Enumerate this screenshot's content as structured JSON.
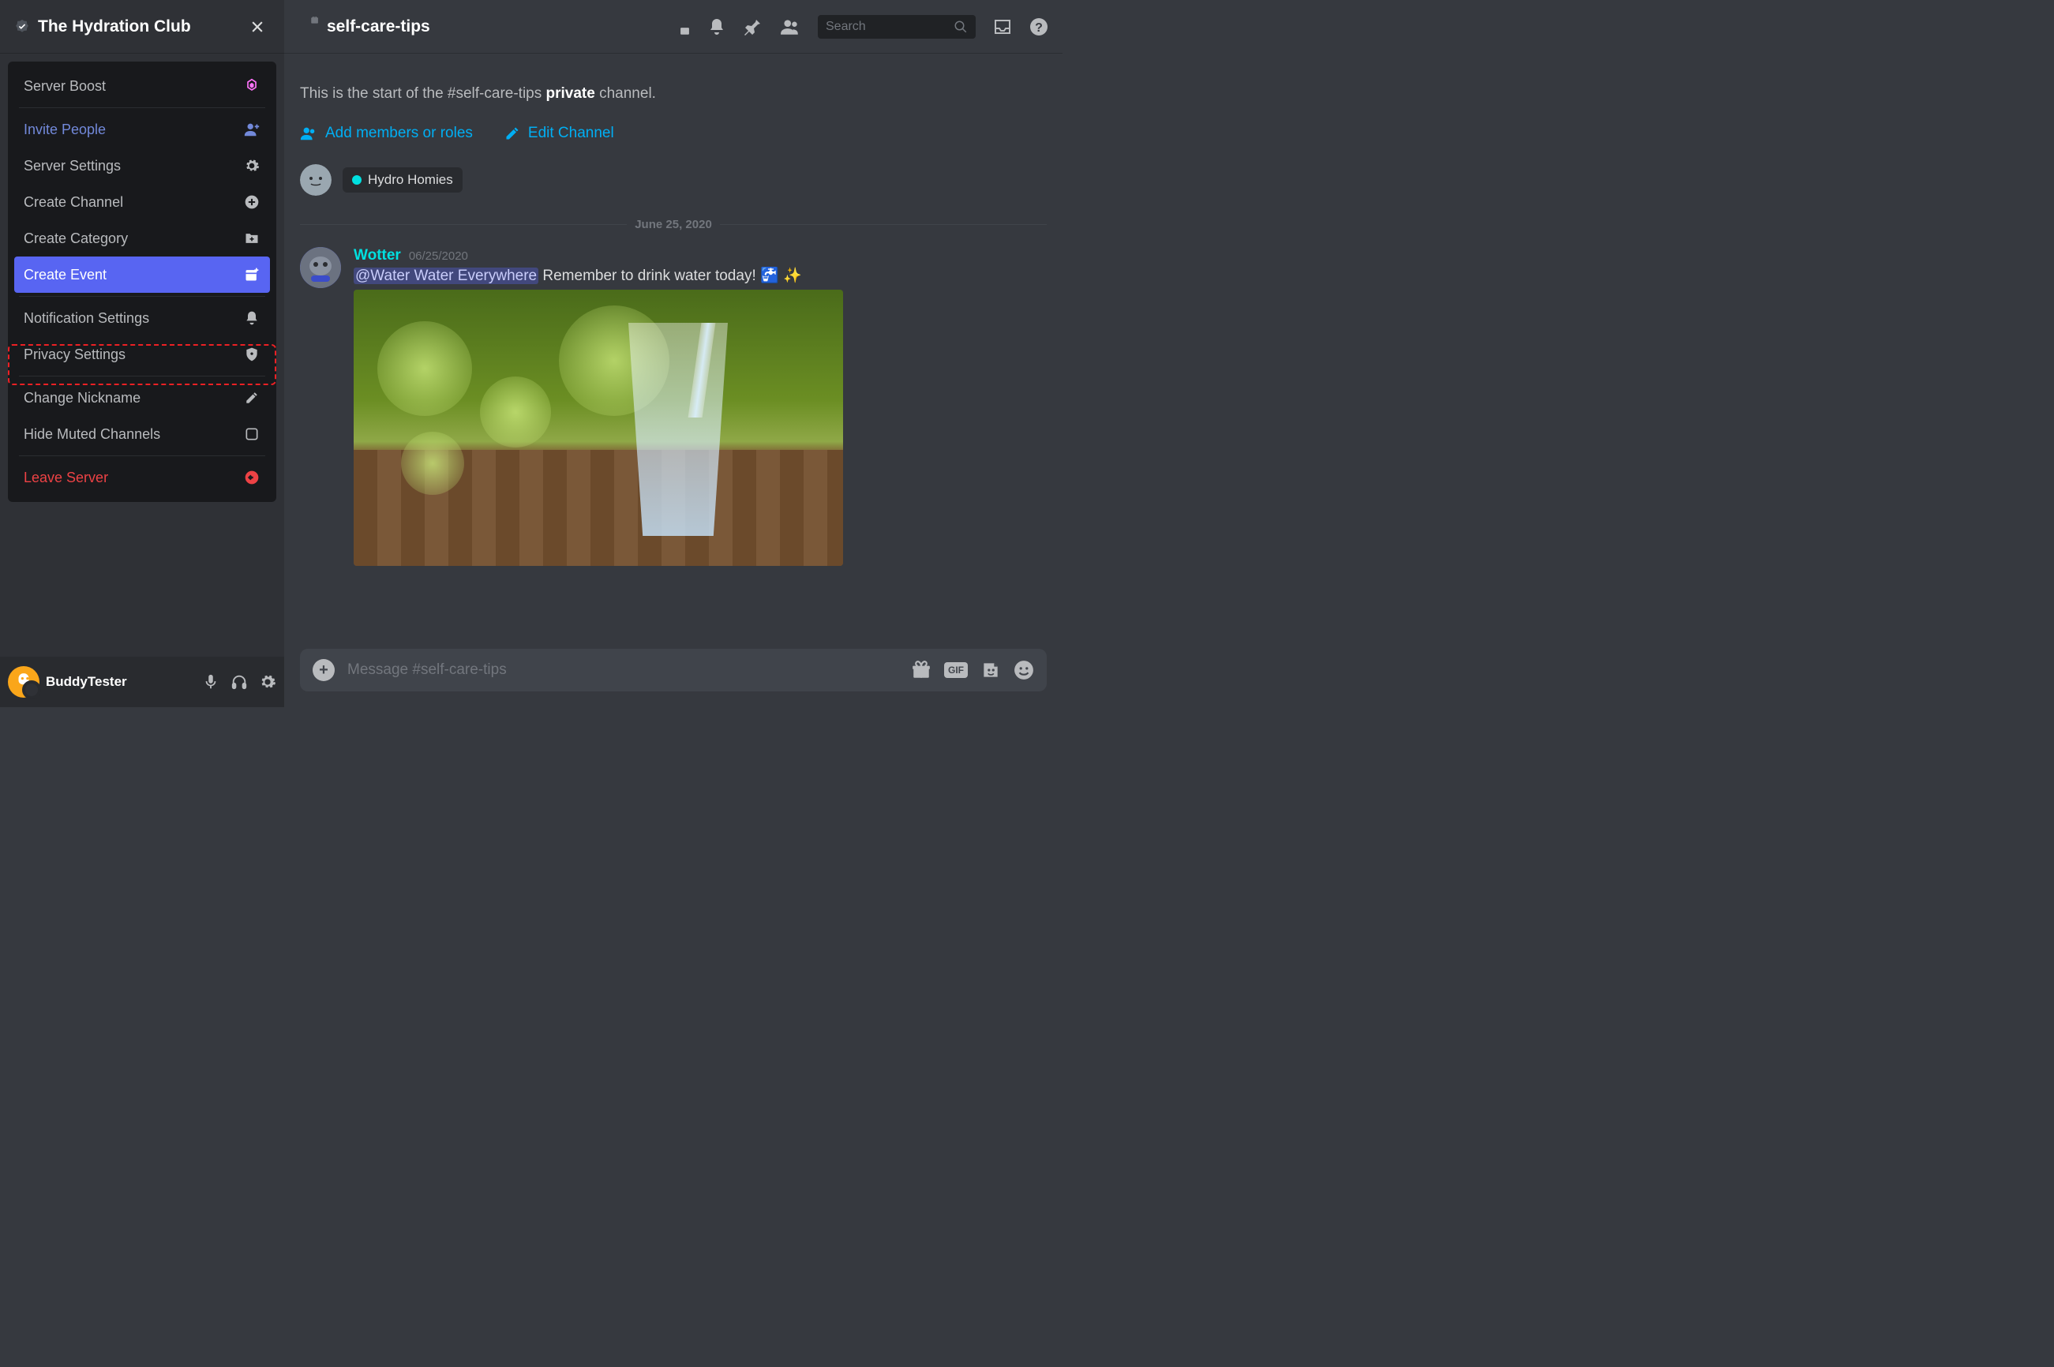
{
  "server": {
    "name": "The Hydration Club"
  },
  "menu": {
    "server_boost": "Server Boost",
    "invite_people": "Invite People",
    "server_settings": "Server Settings",
    "create_channel": "Create Channel",
    "create_category": "Create Category",
    "create_event": "Create Event",
    "notification_settings": "Notification Settings",
    "privacy_settings": "Privacy Settings",
    "change_nickname": "Change Nickname",
    "hide_muted_channels": "Hide Muted Channels",
    "leave_server": "Leave Server"
  },
  "user": {
    "name": "BuddyTester"
  },
  "channel": {
    "name": "self-care-tips"
  },
  "header": {
    "search_placeholder": "Search"
  },
  "welcome": {
    "subtitle_prefix": "This is the start of the #self-care-tips ",
    "subtitle_private": "private",
    "subtitle_suffix": " channel.",
    "add_members": "Add members or roles",
    "edit_channel": "Edit Channel"
  },
  "role_chip": {
    "name": "Hydro Homies",
    "dot_color": "#00e0e0"
  },
  "date_divider": "June 25, 2020",
  "message": {
    "author": "Wotter",
    "date": "06/25/2020",
    "mention": "@Water Water Everywhere",
    "text_after": " Remember to drink water today! ",
    "emoji1": "🚰",
    "emoji2": "✨"
  },
  "composer": {
    "placeholder": "Message #self-care-tips",
    "gif": "GIF"
  }
}
